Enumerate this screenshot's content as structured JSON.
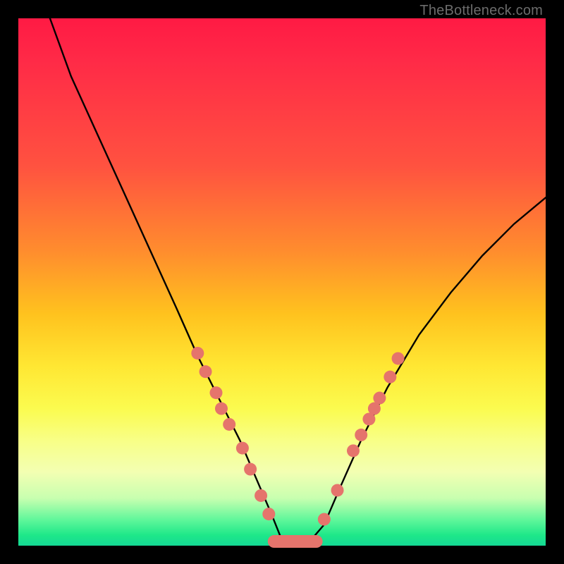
{
  "attribution": "TheBottleneck.com",
  "chart_data": {
    "type": "line",
    "title": "",
    "xlabel": "",
    "ylabel": "",
    "xlim": [
      0,
      100
    ],
    "ylim": [
      0,
      100
    ],
    "series": [
      {
        "name": "bottleneck-curve",
        "x": [
          6,
          10,
          15,
          20,
          25,
          30,
          34,
          38,
          42,
          45,
          48,
          50,
          52,
          55,
          58,
          61,
          65,
          70,
          76,
          82,
          88,
          94,
          100
        ],
        "y": [
          100,
          89,
          78,
          67,
          56,
          45,
          36,
          28,
          20,
          13,
          6,
          1,
          0.5,
          0.5,
          4,
          11,
          20,
          30,
          40,
          48,
          55,
          61,
          66
        ]
      }
    ],
    "markers": {
      "name": "data-points",
      "color": "#e5746c",
      "points": [
        {
          "x": 34.0,
          "y": 36.5
        },
        {
          "x": 35.5,
          "y": 33.0
        },
        {
          "x": 37.5,
          "y": 29.0
        },
        {
          "x": 38.5,
          "y": 26.0
        },
        {
          "x": 40.0,
          "y": 23.0
        },
        {
          "x": 42.5,
          "y": 18.5
        },
        {
          "x": 44.0,
          "y": 14.5
        },
        {
          "x": 46.0,
          "y": 9.5
        },
        {
          "x": 47.5,
          "y": 6.0
        },
        {
          "x": 58.0,
          "y": 5.0
        },
        {
          "x": 60.5,
          "y": 10.5
        },
        {
          "x": 63.5,
          "y": 18.0
        },
        {
          "x": 65.0,
          "y": 21.0
        },
        {
          "x": 66.5,
          "y": 24.0
        },
        {
          "x": 67.5,
          "y": 26.0
        },
        {
          "x": 68.5,
          "y": 28.0
        },
        {
          "x": 70.5,
          "y": 32.0
        },
        {
          "x": 72.0,
          "y": 35.5
        }
      ]
    },
    "flat_segment": {
      "name": "optimal-range",
      "color": "#e5746c",
      "x_start": 48.5,
      "x_end": 56.5,
      "y": 0.8
    }
  }
}
